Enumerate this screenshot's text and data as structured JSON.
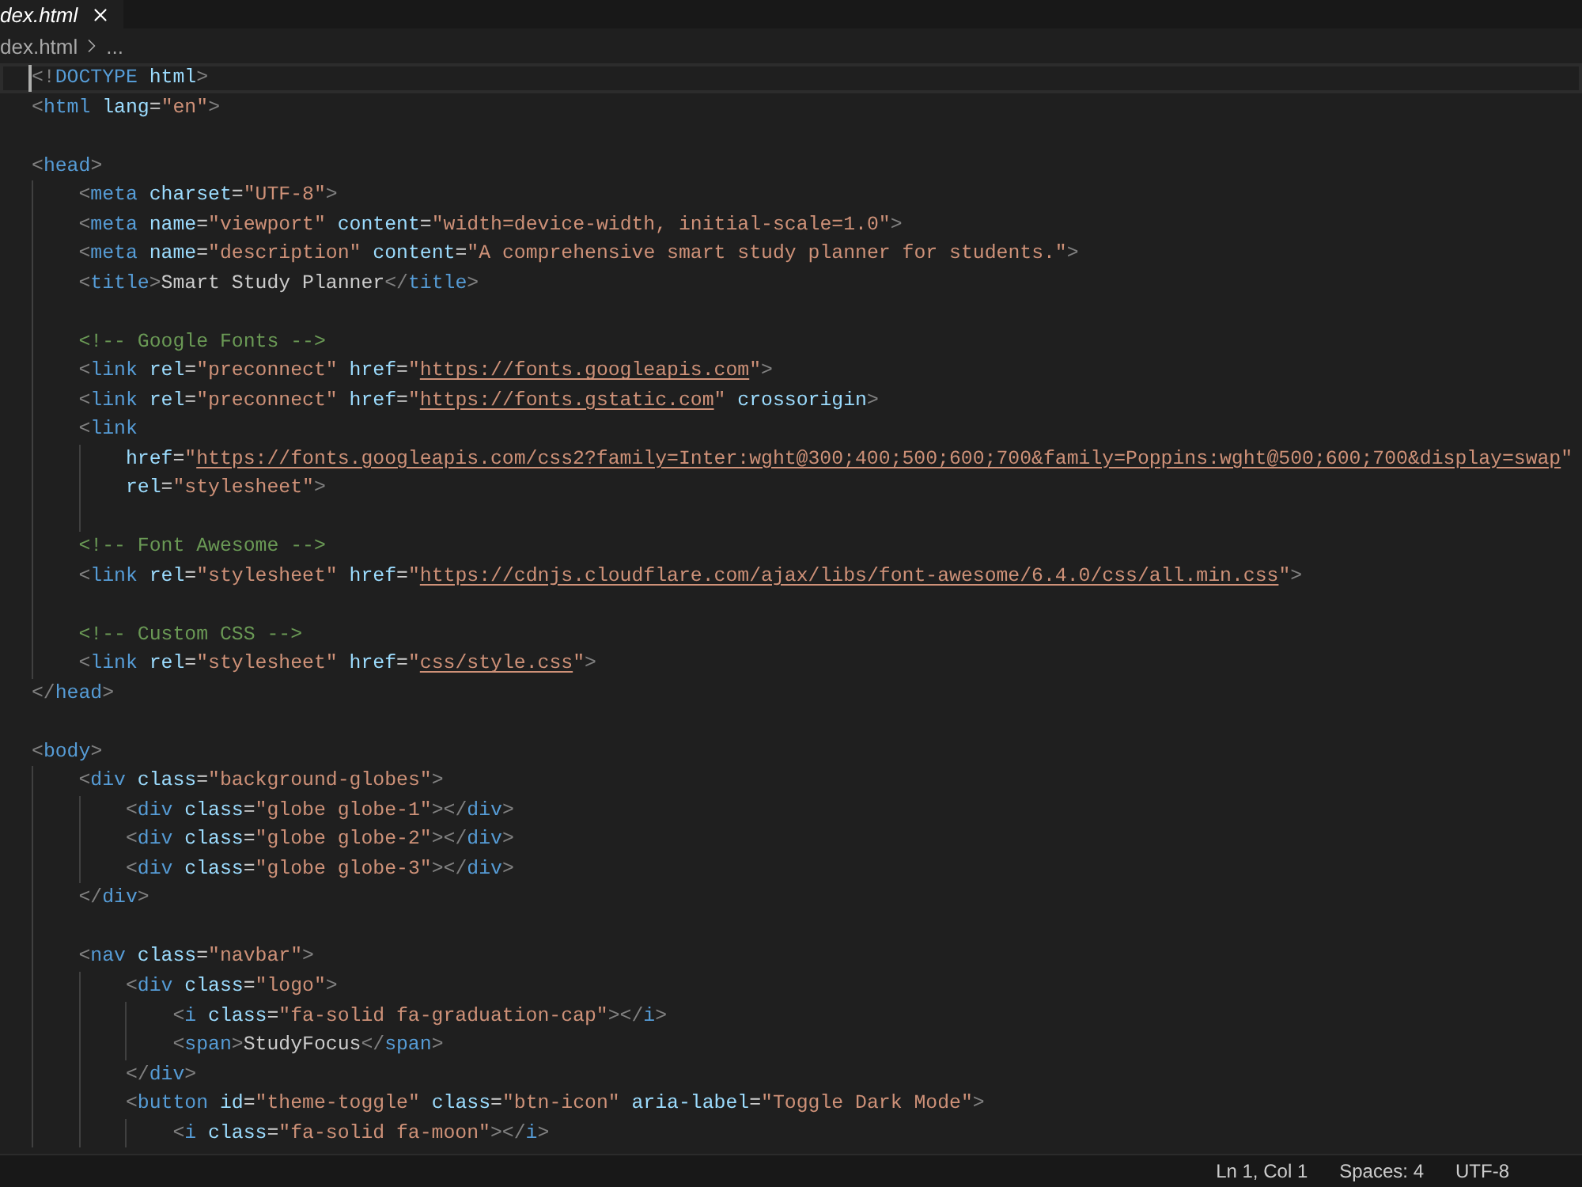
{
  "tabs": [
    {
      "label": "dex.html",
      "selected": true,
      "preview": true
    }
  ],
  "breadcrumb": [
    "dex.html",
    "..."
  ],
  "editor": {
    "lines": [
      {
        "kind": "code",
        "active": true,
        "tokens": [
          {
            "kind": "bracket",
            "text": "<!"
          },
          {
            "kind": "tag",
            "text": "DOCTYPE"
          },
          {
            "kind": "attr",
            "text": " html"
          },
          {
            "kind": "bracket",
            "text": ">"
          }
        ]
      },
      {
        "kind": "code",
        "active": false,
        "tokens": [
          {
            "kind": "bracket",
            "text": "<"
          },
          {
            "kind": "tag",
            "text": "html"
          },
          {
            "kind": "attr",
            "text": " lang"
          },
          {
            "kind": "punct",
            "text": "="
          },
          {
            "kind": "string",
            "text": "\"en\""
          },
          {
            "kind": "bracket",
            "text": ">"
          }
        ]
      },
      {
        "kind": "blank",
        "active": false
      },
      {
        "kind": "code",
        "active": false,
        "tokens": [
          {
            "kind": "bracket",
            "text": "<"
          },
          {
            "kind": "tag",
            "text": "head"
          },
          {
            "kind": "bracket",
            "text": ">"
          }
        ],
        "children": [
          {
            "kind": "code",
            "active": false,
            "tokens": [
              {
                "kind": "bracket",
                "text": "<"
              },
              {
                "kind": "tag",
                "text": "meta"
              },
              {
                "kind": "attr",
                "text": " charset"
              },
              {
                "kind": "punct",
                "text": "="
              },
              {
                "kind": "string",
                "text": "\"UTF-8\""
              },
              {
                "kind": "bracket",
                "text": ">"
              }
            ]
          },
          {
            "kind": "code",
            "active": false,
            "tokens": [
              {
                "kind": "bracket",
                "text": "<"
              },
              {
                "kind": "tag",
                "text": "meta"
              },
              {
                "kind": "attr",
                "text": " name"
              },
              {
                "kind": "punct",
                "text": "="
              },
              {
                "kind": "string",
                "text": "\"viewport\""
              },
              {
                "kind": "attr",
                "text": " content"
              },
              {
                "kind": "punct",
                "text": "="
              },
              {
                "kind": "string",
                "text": "\"width=device-width, initial-scale=1.0\""
              },
              {
                "kind": "bracket",
                "text": ">"
              }
            ]
          },
          {
            "kind": "code",
            "active": false,
            "tokens": [
              {
                "kind": "bracket",
                "text": "<"
              },
              {
                "kind": "tag",
                "text": "meta"
              },
              {
                "kind": "attr",
                "text": " name"
              },
              {
                "kind": "punct",
                "text": "="
              },
              {
                "kind": "string",
                "text": "\"description\""
              },
              {
                "kind": "attr",
                "text": " content"
              },
              {
                "kind": "punct",
                "text": "="
              },
              {
                "kind": "string",
                "text": "\"A comprehensive smart study planner for students.\""
              },
              {
                "kind": "bracket",
                "text": ">"
              }
            ]
          },
          {
            "kind": "code",
            "active": false,
            "tokens": [
              {
                "kind": "bracket",
                "text": "<"
              },
              {
                "kind": "tag",
                "text": "title"
              },
              {
                "kind": "bracket",
                "text": ">"
              },
              {
                "kind": "text",
                "text": "Smart Study Planner"
              },
              {
                "kind": "bracket",
                "text": "</"
              },
              {
                "kind": "tag",
                "text": "title"
              },
              {
                "kind": "bracket",
                "text": ">"
              }
            ]
          },
          {
            "kind": "blank",
            "active": false
          },
          {
            "kind": "code",
            "active": false,
            "tokens": [
              {
                "kind": "comment",
                "text": "<!-- Google Fonts -->"
              }
            ]
          },
          {
            "kind": "code",
            "active": false,
            "tokens": [
              {
                "kind": "bracket",
                "text": "<"
              },
              {
                "kind": "tag",
                "text": "link"
              },
              {
                "kind": "attr",
                "text": " rel"
              },
              {
                "kind": "punct",
                "text": "="
              },
              {
                "kind": "string",
                "text": "\"preconnect\""
              },
              {
                "kind": "attr",
                "text": " href"
              },
              {
                "kind": "punct",
                "text": "="
              },
              {
                "kind": "string",
                "text": "\""
              },
              {
                "kind": "link",
                "text": "https://fonts.googleapis.com"
              },
              {
                "kind": "string",
                "text": "\""
              },
              {
                "kind": "bracket",
                "text": ">"
              }
            ]
          },
          {
            "kind": "code",
            "active": false,
            "tokens": [
              {
                "kind": "bracket",
                "text": "<"
              },
              {
                "kind": "tag",
                "text": "link"
              },
              {
                "kind": "attr",
                "text": " rel"
              },
              {
                "kind": "punct",
                "text": "="
              },
              {
                "kind": "string",
                "text": "\"preconnect\""
              },
              {
                "kind": "attr",
                "text": " href"
              },
              {
                "kind": "punct",
                "text": "="
              },
              {
                "kind": "string",
                "text": "\""
              },
              {
                "kind": "link",
                "text": "https://fonts.gstatic.com"
              },
              {
                "kind": "string",
                "text": "\""
              },
              {
                "kind": "attr",
                "text": " crossorigin"
              },
              {
                "kind": "bracket",
                "text": ">"
              }
            ]
          },
          {
            "kind": "code",
            "active": false,
            "tokens": [
              {
                "kind": "bracket",
                "text": "<"
              },
              {
                "kind": "tag",
                "text": "link"
              }
            ],
            "children": [
              {
                "kind": "code",
                "active": false,
                "tokens": [
                  {
                    "kind": "attr",
                    "text": "href"
                  },
                  {
                    "kind": "punct",
                    "text": "="
                  },
                  {
                    "kind": "string",
                    "text": "\""
                  },
                  {
                    "kind": "link",
                    "text": "https://fonts.googleapis.com/css2?family=Inter:wght@300;400;500;600;700&family=Poppins:wght@500;600;700&display=swap"
                  },
                  {
                    "kind": "string",
                    "text": "\""
                  }
                ]
              },
              {
                "kind": "code",
                "active": false,
                "tokens": [
                  {
                    "kind": "attr",
                    "text": "rel"
                  },
                  {
                    "kind": "punct",
                    "text": "="
                  },
                  {
                    "kind": "string",
                    "text": "\"stylesheet\""
                  },
                  {
                    "kind": "bracket",
                    "text": ">"
                  }
                ]
              },
              {
                "kind": "blank",
                "active": false
              }
            ]
          },
          {
            "kind": "code",
            "active": false,
            "tokens": [
              {
                "kind": "comment",
                "text": "<!-- Font Awesome -->"
              }
            ]
          },
          {
            "kind": "code",
            "active": false,
            "tokens": [
              {
                "kind": "bracket",
                "text": "<"
              },
              {
                "kind": "tag",
                "text": "link"
              },
              {
                "kind": "attr",
                "text": " rel"
              },
              {
                "kind": "punct",
                "text": "="
              },
              {
                "kind": "string",
                "text": "\"stylesheet\""
              },
              {
                "kind": "attr",
                "text": " href"
              },
              {
                "kind": "punct",
                "text": "="
              },
              {
                "kind": "string",
                "text": "\""
              },
              {
                "kind": "link",
                "text": "https://cdnjs.cloudflare.com/ajax/libs/font-awesome/6.4.0/css/all.min.css"
              },
              {
                "kind": "string",
                "text": "\""
              },
              {
                "kind": "bracket",
                "text": ">"
              }
            ]
          },
          {
            "kind": "blank",
            "active": false
          },
          {
            "kind": "code",
            "active": false,
            "tokens": [
              {
                "kind": "comment",
                "text": "<!-- Custom CSS -->"
              }
            ]
          },
          {
            "kind": "code",
            "active": false,
            "tokens": [
              {
                "kind": "bracket",
                "text": "<"
              },
              {
                "kind": "tag",
                "text": "link"
              },
              {
                "kind": "attr",
                "text": " rel"
              },
              {
                "kind": "punct",
                "text": "="
              },
              {
                "kind": "string",
                "text": "\"stylesheet\""
              },
              {
                "kind": "attr",
                "text": " href"
              },
              {
                "kind": "punct",
                "text": "="
              },
              {
                "kind": "string",
                "text": "\""
              },
              {
                "kind": "link",
                "text": "css/style.css"
              },
              {
                "kind": "string",
                "text": "\""
              },
              {
                "kind": "bracket",
                "text": ">"
              }
            ]
          }
        ]
      },
      {
        "kind": "code",
        "active": false,
        "tokens": [
          {
            "kind": "bracket",
            "text": "</"
          },
          {
            "kind": "tag",
            "text": "head"
          },
          {
            "kind": "bracket",
            "text": ">"
          }
        ]
      },
      {
        "kind": "blank",
        "active": false
      },
      {
        "kind": "code",
        "active": false,
        "tokens": [
          {
            "kind": "bracket",
            "text": "<"
          },
          {
            "kind": "tag",
            "text": "body"
          },
          {
            "kind": "bracket",
            "text": ">"
          }
        ],
        "children": [
          {
            "kind": "code",
            "active": false,
            "tokens": [
              {
                "kind": "bracket",
                "text": "<"
              },
              {
                "kind": "tag",
                "text": "div"
              },
              {
                "kind": "attr",
                "text": " class"
              },
              {
                "kind": "punct",
                "text": "="
              },
              {
                "kind": "string",
                "text": "\"background-globes\""
              },
              {
                "kind": "bracket",
                "text": ">"
              }
            ],
            "children": [
              {
                "kind": "code",
                "active": false,
                "tokens": [
                  {
                    "kind": "bracket",
                    "text": "<"
                  },
                  {
                    "kind": "tag",
                    "text": "div"
                  },
                  {
                    "kind": "attr",
                    "text": " class"
                  },
                  {
                    "kind": "punct",
                    "text": "="
                  },
                  {
                    "kind": "string",
                    "text": "\"globe globe-1\""
                  },
                  {
                    "kind": "bracket",
                    "text": "></"
                  },
                  {
                    "kind": "tag",
                    "text": "div"
                  },
                  {
                    "kind": "bracket",
                    "text": ">"
                  }
                ]
              },
              {
                "kind": "code",
                "active": false,
                "tokens": [
                  {
                    "kind": "bracket",
                    "text": "<"
                  },
                  {
                    "kind": "tag",
                    "text": "div"
                  },
                  {
                    "kind": "attr",
                    "text": " class"
                  },
                  {
                    "kind": "punct",
                    "text": "="
                  },
                  {
                    "kind": "string",
                    "text": "\"globe globe-2\""
                  },
                  {
                    "kind": "bracket",
                    "text": "></"
                  },
                  {
                    "kind": "tag",
                    "text": "div"
                  },
                  {
                    "kind": "bracket",
                    "text": ">"
                  }
                ]
              },
              {
                "kind": "code",
                "active": false,
                "tokens": [
                  {
                    "kind": "bracket",
                    "text": "<"
                  },
                  {
                    "kind": "tag",
                    "text": "div"
                  },
                  {
                    "kind": "attr",
                    "text": " class"
                  },
                  {
                    "kind": "punct",
                    "text": "="
                  },
                  {
                    "kind": "string",
                    "text": "\"globe globe-3\""
                  },
                  {
                    "kind": "bracket",
                    "text": "></"
                  },
                  {
                    "kind": "tag",
                    "text": "div"
                  },
                  {
                    "kind": "bracket",
                    "text": ">"
                  }
                ]
              }
            ]
          },
          {
            "kind": "code",
            "active": false,
            "tokens": [
              {
                "kind": "bracket",
                "text": "</"
              },
              {
                "kind": "tag",
                "text": "div"
              },
              {
                "kind": "bracket",
                "text": ">"
              }
            ]
          },
          {
            "kind": "blank",
            "active": false
          },
          {
            "kind": "code",
            "active": false,
            "tokens": [
              {
                "kind": "bracket",
                "text": "<"
              },
              {
                "kind": "tag",
                "text": "nav"
              },
              {
                "kind": "attr",
                "text": " class"
              },
              {
                "kind": "punct",
                "text": "="
              },
              {
                "kind": "string",
                "text": "\"navbar\""
              },
              {
                "kind": "bracket",
                "text": ">"
              }
            ],
            "children": [
              {
                "kind": "code",
                "active": false,
                "tokens": [
                  {
                    "kind": "bracket",
                    "text": "<"
                  },
                  {
                    "kind": "tag",
                    "text": "div"
                  },
                  {
                    "kind": "attr",
                    "text": " class"
                  },
                  {
                    "kind": "punct",
                    "text": "="
                  },
                  {
                    "kind": "string",
                    "text": "\"logo\""
                  },
                  {
                    "kind": "bracket",
                    "text": ">"
                  }
                ],
                "children": [
                  {
                    "kind": "code",
                    "active": false,
                    "tokens": [
                      {
                        "kind": "bracket",
                        "text": "<"
                      },
                      {
                        "kind": "tag",
                        "text": "i"
                      },
                      {
                        "kind": "attr",
                        "text": " class"
                      },
                      {
                        "kind": "punct",
                        "text": "="
                      },
                      {
                        "kind": "string",
                        "text": "\"fa-solid fa-graduation-cap\""
                      },
                      {
                        "kind": "bracket",
                        "text": "></"
                      },
                      {
                        "kind": "tag",
                        "text": "i"
                      },
                      {
                        "kind": "bracket",
                        "text": ">"
                      }
                    ]
                  },
                  {
                    "kind": "code",
                    "active": false,
                    "tokens": [
                      {
                        "kind": "bracket",
                        "text": "<"
                      },
                      {
                        "kind": "tag",
                        "text": "span"
                      },
                      {
                        "kind": "bracket",
                        "text": ">"
                      },
                      {
                        "kind": "text",
                        "text": "StudyFocus"
                      },
                      {
                        "kind": "bracket",
                        "text": "</"
                      },
                      {
                        "kind": "tag",
                        "text": "span"
                      },
                      {
                        "kind": "bracket",
                        "text": ">"
                      }
                    ]
                  }
                ]
              },
              {
                "kind": "code",
                "active": false,
                "tokens": [
                  {
                    "kind": "bracket",
                    "text": "</"
                  },
                  {
                    "kind": "tag",
                    "text": "div"
                  },
                  {
                    "kind": "bracket",
                    "text": ">"
                  }
                ]
              },
              {
                "kind": "code",
                "active": false,
                "tokens": [
                  {
                    "kind": "bracket",
                    "text": "<"
                  },
                  {
                    "kind": "tag",
                    "text": "button"
                  },
                  {
                    "kind": "attr",
                    "text": " id"
                  },
                  {
                    "kind": "punct",
                    "text": "="
                  },
                  {
                    "kind": "string",
                    "text": "\"theme-toggle\""
                  },
                  {
                    "kind": "attr",
                    "text": " class"
                  },
                  {
                    "kind": "punct",
                    "text": "="
                  },
                  {
                    "kind": "string",
                    "text": "\"btn-icon\""
                  },
                  {
                    "kind": "attr",
                    "text": " aria-label"
                  },
                  {
                    "kind": "punct",
                    "text": "="
                  },
                  {
                    "kind": "string",
                    "text": "\"Toggle Dark Mode\""
                  },
                  {
                    "kind": "bracket",
                    "text": ">"
                  }
                ],
                "children": [
                  {
                    "kind": "code",
                    "active": false,
                    "tokens": [
                      {
                        "kind": "bracket",
                        "text": "<"
                      },
                      {
                        "kind": "tag",
                        "text": "i"
                      },
                      {
                        "kind": "attr",
                        "text": " class"
                      },
                      {
                        "kind": "punct",
                        "text": "="
                      },
                      {
                        "kind": "string",
                        "text": "\"fa-solid fa-moon\""
                      },
                      {
                        "kind": "bracket",
                        "text": "></"
                      },
                      {
                        "kind": "tag",
                        "text": "i"
                      },
                      {
                        "kind": "bracket",
                        "text": ">"
                      }
                    ]
                  }
                ]
              }
            ]
          }
        ]
      }
    ]
  },
  "status_bar": [
    "Ln 1, Col 1",
    "Spaces: 4",
    "UTF-8"
  ]
}
